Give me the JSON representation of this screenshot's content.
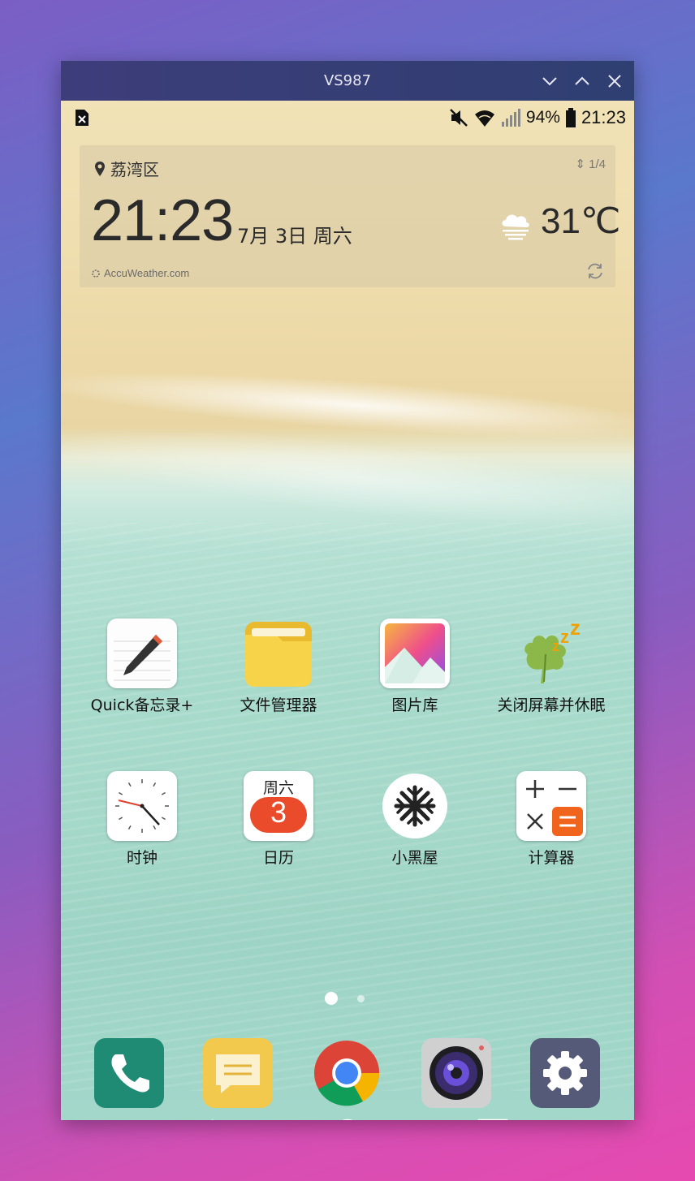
{
  "window": {
    "title": "VS987"
  },
  "titlebar_controls": [
    {
      "name": "minimize",
      "icon": "chevron-down-icon"
    },
    {
      "name": "maximize",
      "icon": "chevron-up-icon"
    },
    {
      "name": "close",
      "icon": "close-icon"
    }
  ],
  "status_bar": {
    "left_icon": "no-sim-icon",
    "icons": [
      "mute-icon",
      "wifi-icon",
      "signal-icon",
      "battery-icon"
    ],
    "battery": "94%",
    "time": "21:23"
  },
  "weather_widget": {
    "location": "荔湾区",
    "page_indicator": "1/4",
    "time": "21:23",
    "date": "7月 3日 周六",
    "temperature": "31℃",
    "provider": "AccuWeather.com",
    "condition_icon": "cloud-fog-icon"
  },
  "apps": [
    {
      "label": "Quick备忘录+",
      "icon": "notepad-icon"
    },
    {
      "label": "文件管理器",
      "icon": "folder-icon"
    },
    {
      "label": "图片库",
      "icon": "gallery-icon"
    },
    {
      "label": "关闭屏幕并休眠",
      "icon": "sleep-leaf-icon"
    },
    {
      "label": "时钟",
      "icon": "clock-icon"
    },
    {
      "label": "日历",
      "icon": "calendar-icon",
      "day": "周六",
      "date": "3"
    },
    {
      "label": "小黑屋",
      "icon": "snowflake-icon"
    },
    {
      "label": "计算器",
      "icon": "calculator-icon"
    }
  ],
  "page_dots": {
    "count": 2,
    "active": 1
  },
  "dock": [
    {
      "name": "phone",
      "icon": "phone-icon"
    },
    {
      "name": "messages",
      "icon": "message-icon"
    },
    {
      "name": "chrome",
      "icon": "chrome-icon"
    },
    {
      "name": "camera",
      "icon": "camera-icon"
    },
    {
      "name": "settings",
      "icon": "gear-icon"
    }
  ],
  "nav_bar": [
    "back-icon",
    "home-icon",
    "recents-icon"
  ],
  "colors": {
    "titlebar": "#3d3d7a",
    "phone": "#1f8b74",
    "messages": "#f2c94c",
    "settings": "#545a77",
    "calendar_badge": "#e94b2b",
    "calculator_equals": "#f0641e"
  }
}
